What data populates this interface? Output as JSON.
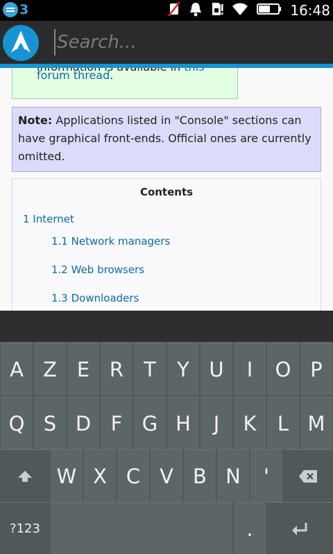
{
  "status_bar": {
    "notification_count": "3",
    "time": "16:48"
  },
  "browser": {
    "search_placeholder": "Search..."
  },
  "page": {
    "green_box": {
      "line1_prefix": "information is available in ",
      "line1_link": "this",
      "line2_link": "forum thread",
      "line2_suffix": "."
    },
    "note": {
      "label": "Note:",
      "text": " Applications listed in \"Console\" sections can have graphical front-ends. Official ones are currently omitted."
    },
    "toc": {
      "title": "Contents",
      "items": [
        "1 Internet",
        "1.1 Network managers",
        "1.2 Web browsers",
        "1.3 Downloaders"
      ]
    }
  },
  "keyboard": {
    "row1": [
      "A",
      "Z",
      "E",
      "R",
      "T",
      "Y",
      "U",
      "I",
      "O",
      "P"
    ],
    "row2": [
      "Q",
      "S",
      "D",
      "F",
      "G",
      "H",
      "J",
      "K",
      "L",
      "M"
    ],
    "row3": [
      "W",
      "X",
      "C",
      "V",
      "B",
      "N",
      "'"
    ],
    "symbols_key": "?123",
    "period_key": "."
  },
  "colors": {
    "accent": "#1793d1",
    "link": "#0b6ba7",
    "note_bg": "#dcdcfa",
    "green_bg": "#e3ffe3"
  }
}
